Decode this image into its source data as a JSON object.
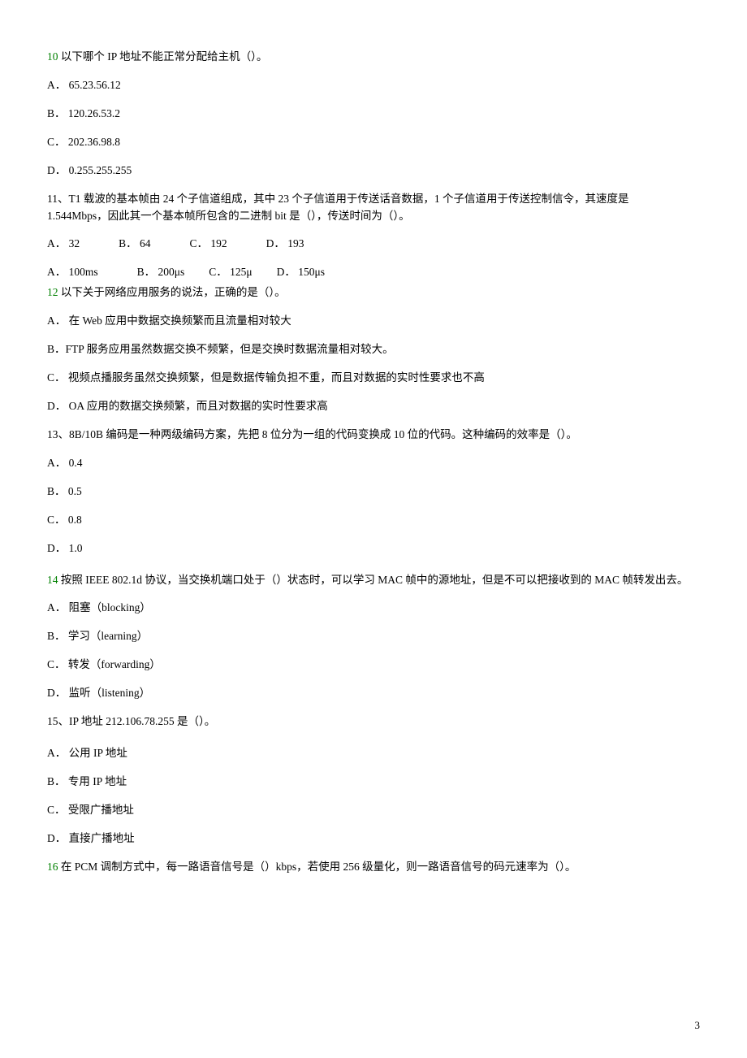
{
  "q10": {
    "num": "10",
    "stem": " 以下哪个 IP 地址不能正常分配给主机（）。",
    "opts": [
      "A． 65.23.56.12",
      "B． 120.26.53.2",
      "C． 202.36.98.8",
      "D． 0.255.255.255"
    ]
  },
  "q11": {
    "line1": "11、T1 载波的基本帧由 24 个子信道组成，其中 23 个子信道用于传送话音数据，1 个子信道用于传送控制信令，其速度是",
    "line2": "1.544Mbps，因此其一个基本帧所包含的二进制 bit 是（），传送时间为（）。",
    "row1": [
      "A． 32",
      "B． 64",
      "C． 192",
      "D． 193"
    ],
    "row2": [
      "A． 100ms",
      "B． 200μs",
      "C． 125μ",
      "D． 150μs"
    ]
  },
  "q12": {
    "num": "12",
    "stem": " 以下关于网络应用服务的说法，正确的是（）。",
    "opts": [
      "A． 在 Web 应用中数据交换频繁而且流量相对较大",
      "B．FTP 服务应用虽然数据交换不频繁，但是交换时数据流量相对较大。",
      "C． 视频点播服务虽然交换频繁，但是数据传输负担不重，而且对数据的实时性要求也不高",
      "D． OA 应用的数据交换频繁，而且对数据的实时性要求高"
    ]
  },
  "q13": {
    "stem": "13、8B/10B 编码是一种两级编码方案，先把 8 位分为一组的代码变换成 10 位的代码。这种编码的效率是（）。",
    "opts": [
      "A． 0.4",
      "B． 0.5",
      "C． 0.8",
      "D． 1.0"
    ]
  },
  "q14": {
    "num": "14",
    "stem": " 按照 IEEE  802.1d 协议，当交换机端口处于（）状态时，可以学习 MAC 帧中的源地址，但是不可以把接收到的 MAC 帧转发出去。",
    "opts": [
      "A． 阻塞（blocking）",
      "B． 学习（learning）",
      "C． 转发（forwarding）",
      "D． 监听（listening）"
    ]
  },
  "q15": {
    "stem": "15、IP 地址 212.106.78.255 是（）。",
    "opts": [
      "A． 公用 IP 地址",
      "B． 专用 IP 地址",
      "C． 受限广播地址",
      "D． 直接广播地址"
    ]
  },
  "q16": {
    "num": "16",
    "stem": " 在 PCM 调制方式中，每一路语音信号是（）kbps，若使用 256 级量化，则一路语音信号的码元速率为（）。"
  },
  "page": "3"
}
